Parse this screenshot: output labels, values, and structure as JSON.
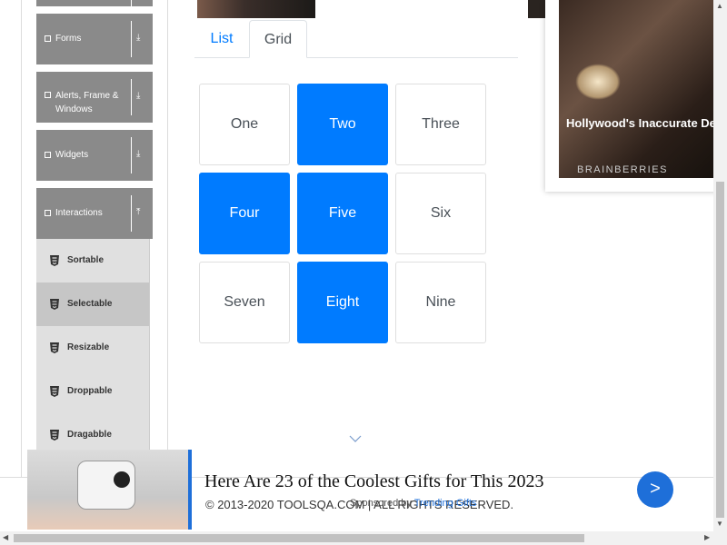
{
  "sidebar": {
    "groups": [
      {
        "label": "Forms"
      },
      {
        "label": "Alerts, Frame & Windows"
      },
      {
        "label": "Widgets"
      },
      {
        "label": "Interactions"
      }
    ],
    "items": [
      {
        "label": "Sortable"
      },
      {
        "label": "Selectable"
      },
      {
        "label": "Resizable"
      },
      {
        "label": "Droppable"
      },
      {
        "label": "Dragabble"
      }
    ]
  },
  "tabs": {
    "list": "List",
    "grid": "Grid",
    "active": "Grid"
  },
  "grid": {
    "cells": [
      {
        "label": "One",
        "selected": false
      },
      {
        "label": "Two",
        "selected": true
      },
      {
        "label": "Three",
        "selected": false
      },
      {
        "label": "Four",
        "selected": true
      },
      {
        "label": "Five",
        "selected": true
      },
      {
        "label": "Six",
        "selected": false
      },
      {
        "label": "Seven",
        "selected": false
      },
      {
        "label": "Eight",
        "selected": true
      },
      {
        "label": "Nine",
        "selected": false
      }
    ],
    "selected_color": "#007bff"
  },
  "side_ad": {
    "headline": "Hollywood's Inaccurate Depictions Of Reality – Take A Look Inside",
    "source": "BRAINBERRIES"
  },
  "footer": {
    "copyright": "© 2013-2020 TOOLSQA.COM | ALL RIGHTS RESERVED."
  },
  "banner_ad": {
    "title": "Here Are 23 of the Coolest Gifts for This 2023",
    "sponsor_prefix": "Sponsored by",
    "sponsor_link": "Trending Gifts",
    "next_label": ">"
  },
  "colors": {
    "accent": "#007bff",
    "sidebar_group": "#8a8a8a",
    "sidebar_item": "#e0e0e0",
    "sidebar_item_active": "#c6c6c6"
  }
}
